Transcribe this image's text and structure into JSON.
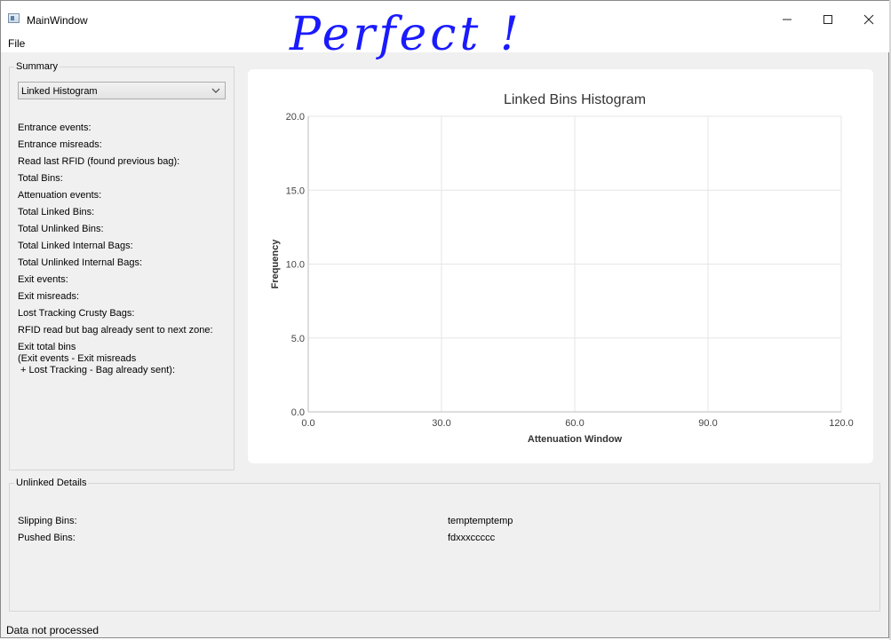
{
  "window": {
    "title": "MainWindow",
    "minimize_icon": "minimize-icon",
    "maximize_icon": "maximize-icon",
    "close_icon": "close-icon"
  },
  "menu": {
    "file": "File"
  },
  "overlay": {
    "handwriting": "Perfect !"
  },
  "summary": {
    "group_title": "Summary",
    "combo_value": "Linked Histogram",
    "rows": [
      "Entrance events:",
      "Entrance misreads:",
      "Read last RFID (found previous bag):",
      "Total Bins:",
      "Attenuation events:",
      "Total Linked Bins:",
      "Total Unlinked Bins:",
      "Total Linked Internal Bags:",
      "Total Unlinked Internal Bags:",
      "Exit events:",
      "Exit misreads:",
      "Lost Tracking Crusty Bags:",
      "RFID read but bag already sent to next zone:",
      "Exit total bins",
      "(Exit events - Exit misreads",
      " + Lost Tracking - Bag already sent):"
    ]
  },
  "chart_data": {
    "type": "bar",
    "title": "Linked Bins Histogram",
    "xlabel": "Attenuation Window",
    "ylabel": "Frequency",
    "xlim": [
      0,
      120
    ],
    "ylim": [
      0,
      20
    ],
    "x_ticks": [
      "0.0",
      "30.0",
      "60.0",
      "90.0",
      "120.0"
    ],
    "y_ticks": [
      "0.0",
      "5.0",
      "10.0",
      "15.0",
      "20.0"
    ],
    "series": [],
    "grid": true
  },
  "unlinked": {
    "group_title": "Unlinked Details",
    "rows": [
      {
        "label": "Slipping Bins:",
        "value": "temptemptemp"
      },
      {
        "label": "Pushed Bins:",
        "value": "fdxxxccccc"
      }
    ]
  },
  "status": {
    "text": "Data not processed"
  },
  "colors": {
    "window_bg": "#f0f0f0",
    "ink": "#1a1aff",
    "grid": "#e6e6e6"
  }
}
